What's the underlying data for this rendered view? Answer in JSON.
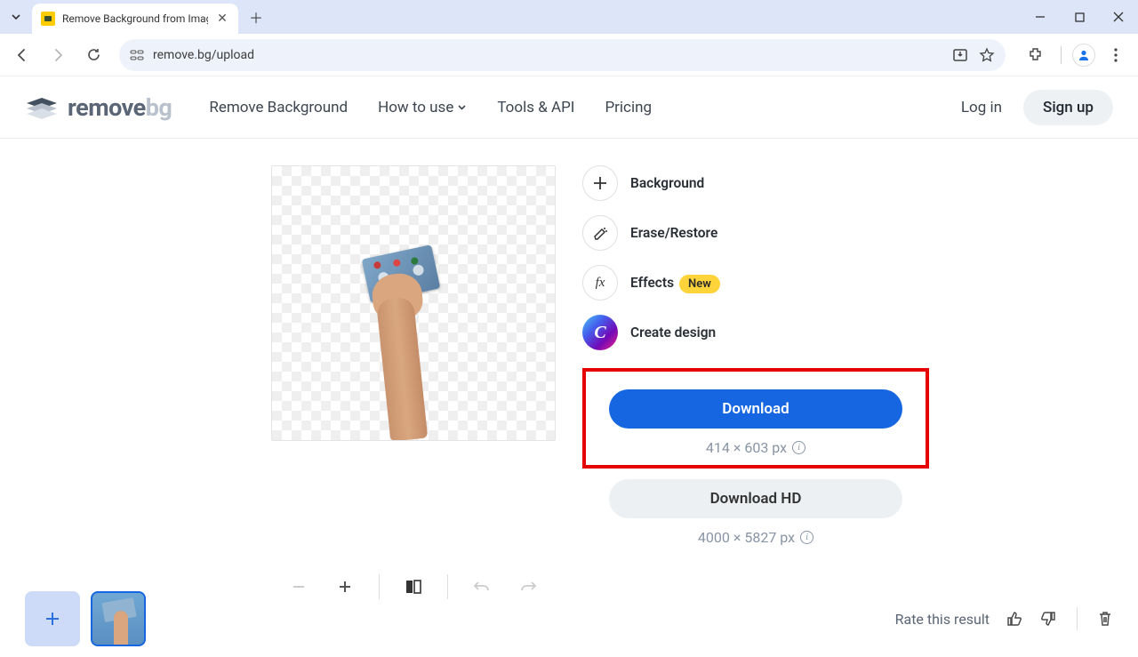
{
  "browser": {
    "tab_title": "Remove Background from Imag",
    "url": "remove.bg/upload"
  },
  "header": {
    "logo_remove": "remove",
    "logo_bg": "bg",
    "nav": {
      "remove_bg": "Remove Background",
      "how_to_use": "How to use",
      "tools_api": "Tools & API",
      "pricing": "Pricing"
    },
    "login": "Log in",
    "signup": "Sign up"
  },
  "tools": {
    "background": "Background",
    "erase_restore": "Erase/Restore",
    "effects": "Effects",
    "effects_badge": "New",
    "create_design": "Create design"
  },
  "download": {
    "primary_label": "Download",
    "primary_dimensions": "414 × 603 px",
    "hd_label": "Download HD",
    "hd_dimensions": "4000 × 5827 px"
  },
  "footer": {
    "rate_label": "Rate this result"
  }
}
